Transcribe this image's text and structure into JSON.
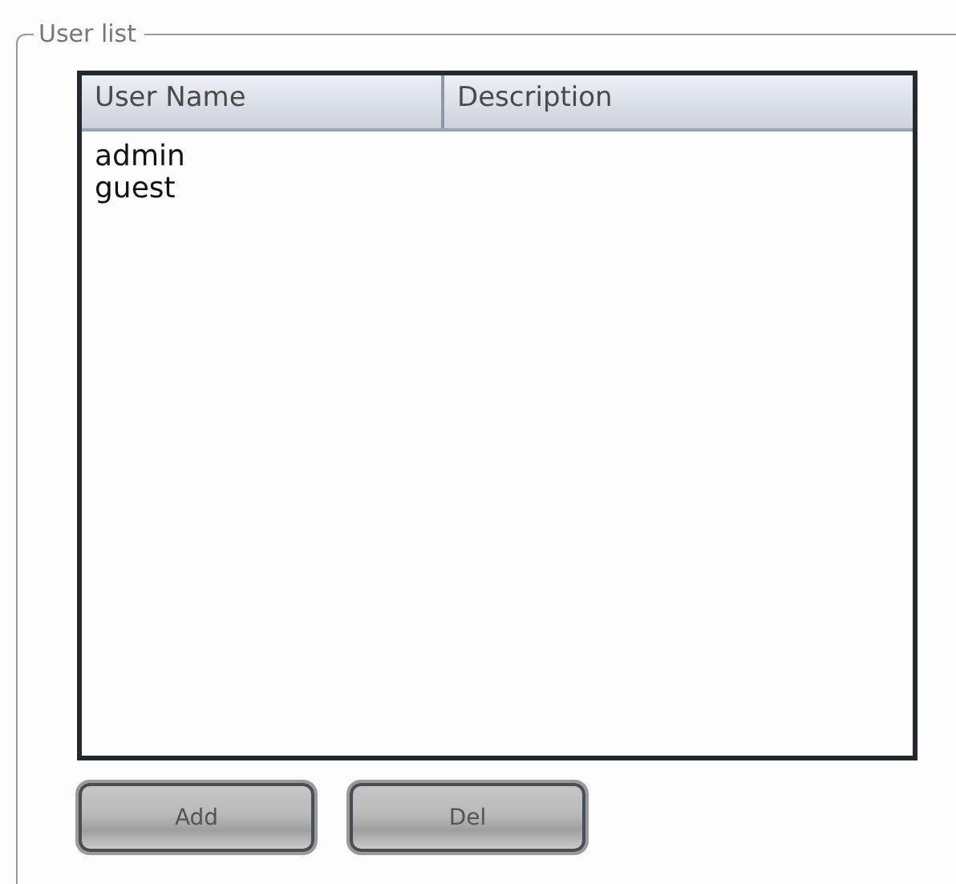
{
  "group": {
    "title": "User list"
  },
  "table": {
    "columns": [
      "User Name",
      "Description"
    ],
    "rows": [
      {
        "user_name": "admin"
      },
      {
        "user_name": "guest"
      }
    ]
  },
  "buttons": [
    "Add",
    "Del"
  ]
}
